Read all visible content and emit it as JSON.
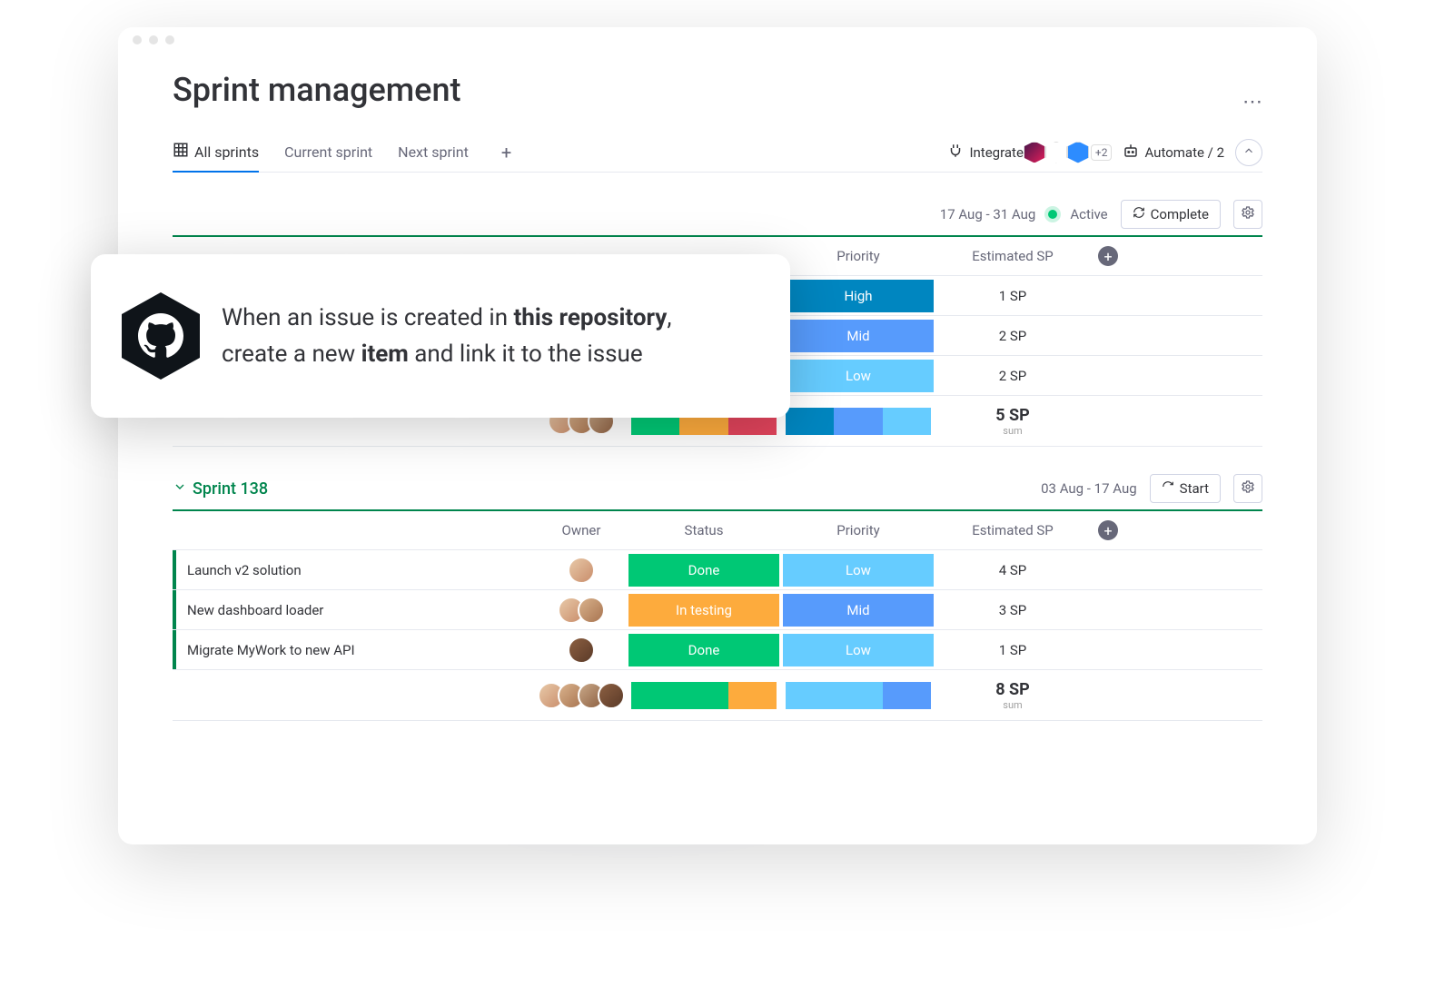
{
  "page": {
    "title": "Sprint management"
  },
  "tabs": {
    "t0": "All sprints",
    "t1": "Current sprint",
    "t2": "Next sprint"
  },
  "topbar": {
    "integrate": "Integrate",
    "integrations_extra": "+2",
    "automate": "Automate / 2"
  },
  "automation": {
    "prefix": "When an issue is created in ",
    "bold1": "this repository",
    "comma": ",",
    "mid": "create a new ",
    "bold2": "item",
    "suffix": " and link it to the issue"
  },
  "sprint1": {
    "dates": "17 Aug - 31 Aug",
    "status": "Active",
    "action": "Complete",
    "cols": {
      "priority": "Priority",
      "sp": "Estimated SP"
    },
    "rows": [
      {
        "priority": "High",
        "priority_color": "#0086c0",
        "sp": "1 SP"
      },
      {
        "priority": "Mid",
        "priority_color": "#579bfc",
        "sp": "2 SP"
      },
      {
        "priority": "Low",
        "priority_color": "#66ccff",
        "sp": "2 SP"
      }
    ],
    "summary": {
      "sp": "5 SP",
      "label": "sum"
    }
  },
  "sprint2": {
    "name": "Sprint 138",
    "dates": "03 Aug - 17 Aug",
    "action": "Start",
    "cols": {
      "owner": "Owner",
      "status": "Status",
      "priority": "Priority",
      "sp": "Estimated SP"
    },
    "rows": [
      {
        "task": "Launch v2 solution",
        "status": "Done",
        "status_color": "#00c875",
        "priority": "Low",
        "priority_color": "#66ccff",
        "sp": "4 SP"
      },
      {
        "task": "New dashboard loader",
        "status": "In testing",
        "status_color": "#fdab3d",
        "priority": "Mid",
        "priority_color": "#579bfc",
        "sp": "3 SP"
      },
      {
        "task": "Migrate MyWork to new API",
        "status": "Done",
        "status_color": "#00c875",
        "priority": "Low",
        "priority_color": "#66ccff",
        "sp": "1 SP"
      }
    ],
    "summary": {
      "sp": "8 SP",
      "label": "sum"
    }
  },
  "menu_dots": "⋯"
}
